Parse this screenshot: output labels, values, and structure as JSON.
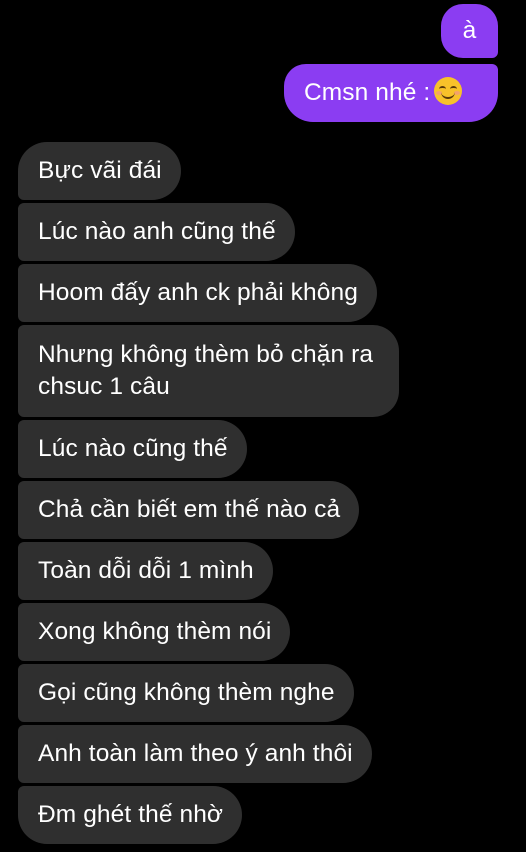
{
  "conversation": {
    "sent": [
      {
        "text": "à"
      },
      {
        "text": "Cmsn nhé :",
        "emoji": "smiling-face-icon"
      }
    ],
    "received": [
      {
        "text": "Bực vãi đái"
      },
      {
        "text": "Lúc nào anh cũng thế"
      },
      {
        "text": "Hoom đấy anh ck phải không"
      },
      {
        "line1": "Nhưng không thèm bỏ chặn ra",
        "line2": "chsuc 1 câu"
      },
      {
        "text": "Lúc nào cũng thế"
      },
      {
        "text": "Chả cần biết em thế nào cả"
      },
      {
        "text": "Toàn dỗi dỗi 1 mình"
      },
      {
        "text": "Xong không thèm nói"
      },
      {
        "text": "Gọi cũng không thèm nghe"
      },
      {
        "text": "Anh toàn làm theo ý anh thôi"
      },
      {
        "text": "Đm ghét thế nhờ"
      }
    ]
  },
  "colors": {
    "background": "#000000",
    "sent_bubble": "#8b3df2",
    "received_bubble": "#2f2f2f",
    "text": "#ffffff"
  }
}
